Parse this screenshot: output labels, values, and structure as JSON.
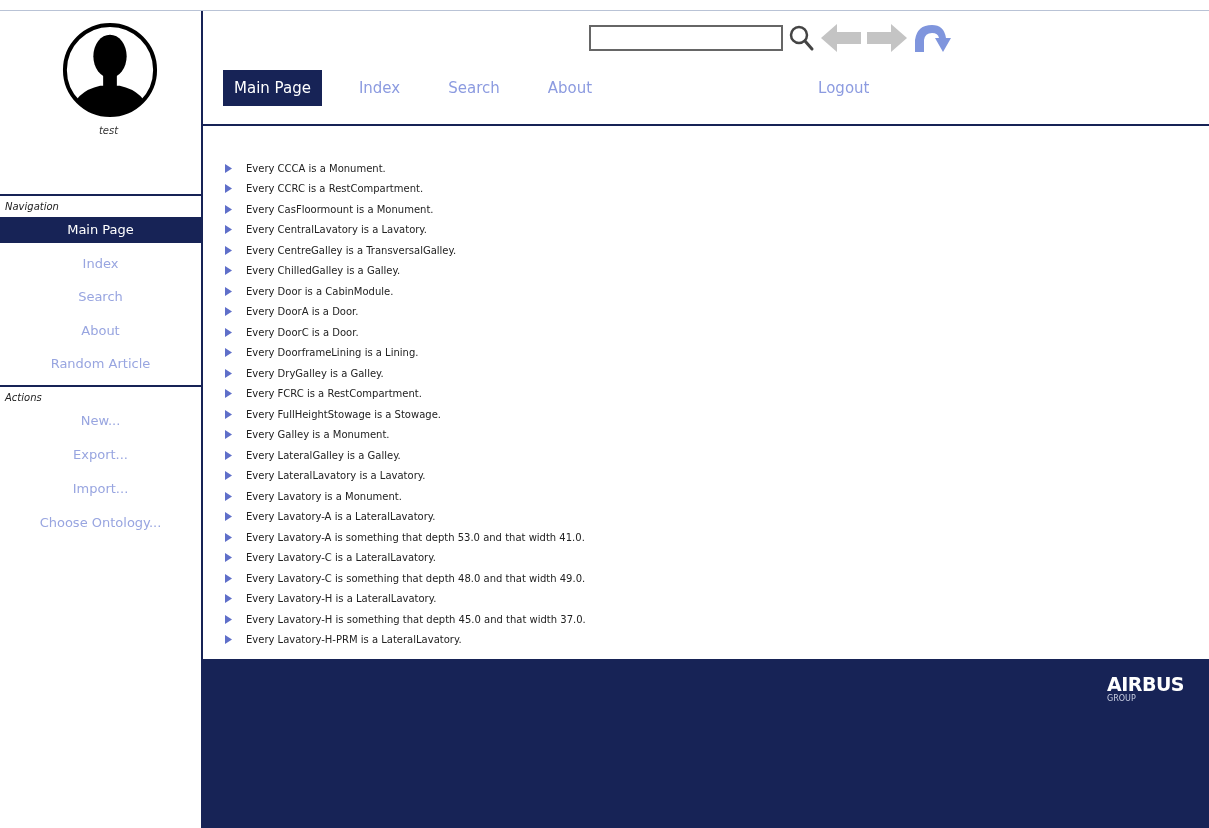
{
  "user": {
    "name": "test"
  },
  "sidebar": {
    "sections": [
      {
        "title": "Navigation",
        "items": [
          {
            "label": "Main Page",
            "selected": true
          },
          {
            "label": "Index",
            "selected": false
          },
          {
            "label": "Search",
            "selected": false
          },
          {
            "label": "About",
            "selected": false
          },
          {
            "label": "Random Article",
            "selected": false
          }
        ]
      },
      {
        "title": "Actions",
        "items": [
          {
            "label": "New...",
            "selected": false
          },
          {
            "label": "Export...",
            "selected": false
          },
          {
            "label": "Import...",
            "selected": false
          },
          {
            "label": "Choose Ontology...",
            "selected": false
          }
        ]
      }
    ]
  },
  "toolbar": {
    "buttons": [
      {
        "kind": "back",
        "disabled": true
      },
      {
        "kind": "forward",
        "disabled": true
      },
      {
        "kind": "redo",
        "disabled": false
      }
    ]
  },
  "tabs": [
    {
      "label": "Main Page",
      "selected": true
    },
    {
      "label": "Index",
      "selected": false
    },
    {
      "label": "Search",
      "selected": false
    },
    {
      "label": "About",
      "selected": false
    }
  ],
  "logout": "Logout",
  "statements": [
    "Every CCCA is a Monument.",
    "Every CCRC is a RestCompartment.",
    "Every CasFloormount is a Monument.",
    "Every CentralLavatory is a Lavatory.",
    "Every CentreGalley is a TransversalGalley.",
    "Every ChilledGalley is a Galley.",
    "Every Door is a CabinModule.",
    "Every DoorA is a Door.",
    "Every DoorC is a Door.",
    "Every DoorframeLining is a Lining.",
    "Every DryGalley is a Galley.",
    "Every FCRC is a RestCompartment.",
    "Every FullHeightStowage is a Stowage.",
    "Every Galley is a Monument.",
    "Every LateralGalley is a Galley.",
    "Every LateralLavatory is a Lavatory.",
    "Every Lavatory is a Monument.",
    "Every Lavatory-A is a LateralLavatory.",
    "Every Lavatory-A is something that depth 53.0 and that width 41.0.",
    "Every Lavatory-C is a LateralLavatory.",
    "Every Lavatory-C is something that depth 48.0 and that width 49.0.",
    "Every Lavatory-H is a LateralLavatory.",
    "Every Lavatory-H is something that depth 45.0 and that width 37.0.",
    "Every Lavatory-H-PRM is a LateralLavatory."
  ],
  "footer": {
    "logo": "AIRBUS",
    "logo_subtitle": "GROUP"
  }
}
